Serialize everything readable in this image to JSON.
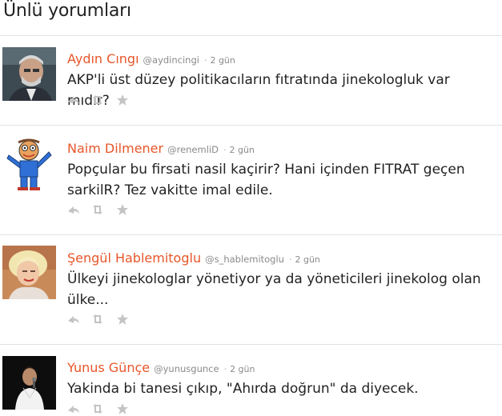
{
  "section": {
    "title": "Ünlü yorumları"
  },
  "icons": {
    "reply": "reply-icon",
    "retweet": "retweet-icon",
    "favorite": "star-icon"
  },
  "colors": {
    "name": "#e8562a",
    "handle": "#8a8a8a",
    "text": "#222222",
    "action_icon": "#c4c4c4",
    "divider": "#e2e2e2"
  },
  "tweets": [
    {
      "name": "Aydın Cıngı",
      "handle": "@aydincingi",
      "separator": "·",
      "time": "2 gün",
      "text": "AKP'li üst düzey politikacıların fıtratında jinekologluk var mıdır?"
    },
    {
      "name": "Naim Dilmener",
      "handle": "@renemliD",
      "separator": "·",
      "time": "2 gün",
      "text": "Popçular bu firsati nasil kaçirir? Hani içinden FITRAT geçen sarkilR? Tez vakitte imal edile."
    },
    {
      "name": "Şengül Hablemitoglu",
      "handle": "@s_hablemitoglu",
      "separator": "·",
      "time": "2 gün",
      "text": "Ülkeyi jinekologlar yönetiyor ya da yöneticileri jinekolog olan ülke..."
    },
    {
      "name": "Yunus Günçe",
      "handle": "@yunusgunce",
      "separator": "·",
      "time": "2 gün",
      "text": "Yakinda bi tanesi çıkıp, \"Ahırda doğrun\" da diyecek."
    }
  ]
}
